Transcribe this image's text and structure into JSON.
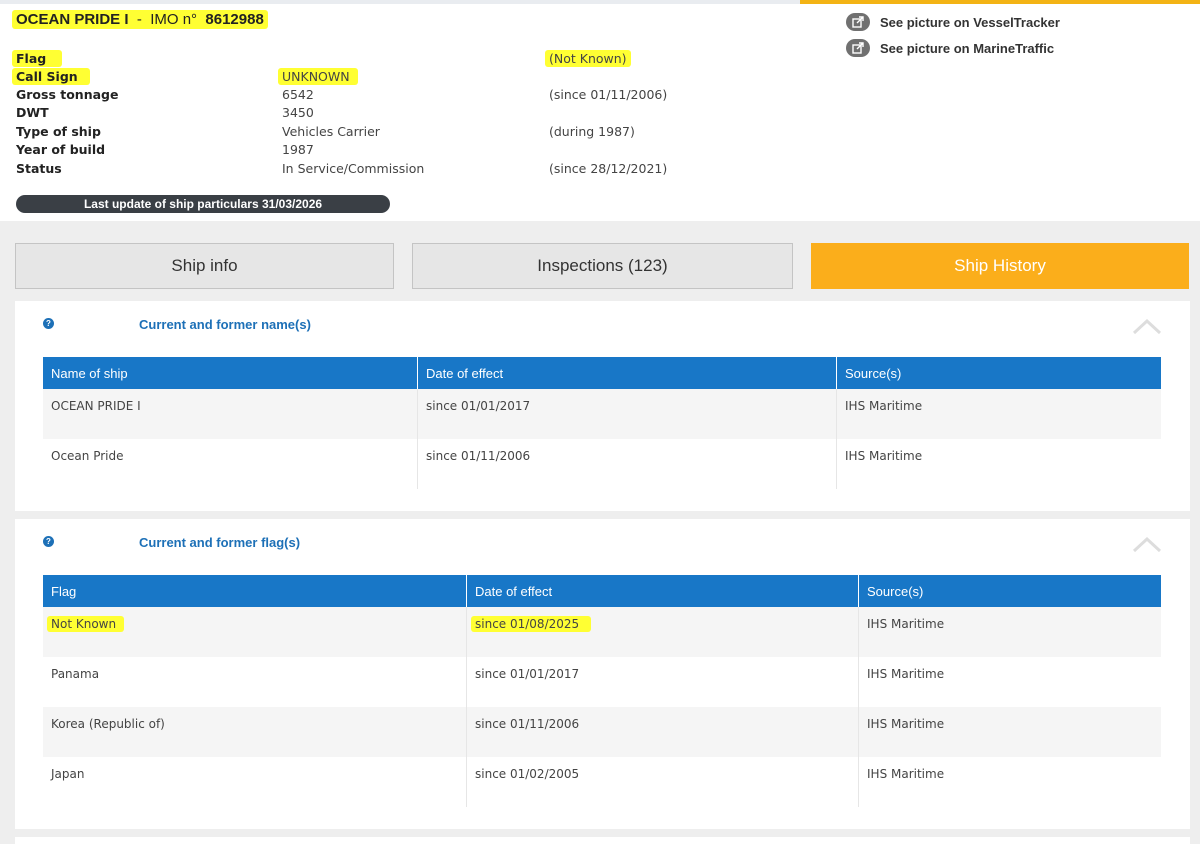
{
  "header": {
    "ship_name": "OCEAN PRIDE I",
    "separator": "-",
    "imo_label": "IMO n°",
    "imo_number": "8612988"
  },
  "links": [
    {
      "label": "See picture on VesselTracker",
      "icon": "external-link-icon"
    },
    {
      "label": "See picture on MarineTraffic",
      "icon": "external-link-icon"
    }
  ],
  "particulars": {
    "flag_label": "Flag",
    "flag_value": "",
    "flag_note": "(Not Known)",
    "call_sign_label": "Call Sign",
    "call_sign_value": "UNKNOWN",
    "call_sign_note": "",
    "gross_label": "Gross tonnage",
    "gross_value": "6542",
    "gross_note": "(since 01/11/2006)",
    "dwt_label": "DWT",
    "dwt_value": "3450",
    "dwt_note": "",
    "type_label": "Type of ship",
    "type_value": "Vehicles Carrier",
    "type_note": "(during 1987)",
    "year_label": "Year of build",
    "year_value": "1987",
    "year_note": "",
    "status_label": "Status",
    "status_value": "In Service/Commission",
    "status_note": "(since 28/12/2021)"
  },
  "last_update": "Last update of ship particulars 31/03/2026",
  "tabs": {
    "ship_info": "Ship info",
    "inspections": "Inspections (123)",
    "ship_history": "Ship History",
    "active": "ship_history"
  },
  "names_section": {
    "title": "Current and former name(s)",
    "columns": [
      "Name of ship",
      "Date of effect",
      "Source(s)"
    ],
    "rows": [
      [
        "OCEAN PRIDE I",
        "since 01/01/2017",
        "IHS Maritime"
      ],
      [
        "Ocean Pride",
        "since 01/11/2006",
        "IHS Maritime"
      ]
    ]
  },
  "flags_section": {
    "title": "Current and former flag(s)",
    "columns": [
      "Flag",
      "Date of effect",
      "Source(s)"
    ],
    "rows": [
      [
        "Not Known",
        "since 01/08/2025",
        "IHS Maritime"
      ],
      [
        "Panama",
        "since 01/01/2017",
        "IHS Maritime"
      ],
      [
        "Korea (Republic of)",
        "since 01/11/2006",
        "IHS Maritime"
      ],
      [
        "Japan",
        "since 01/02/2005",
        "IHS Maritime"
      ]
    ]
  },
  "colors": {
    "accent_orange": "#fbae1b",
    "header_blue": "#1877c7",
    "title_blue": "#1d70b7",
    "highlight_yellow": "#ffff33"
  }
}
